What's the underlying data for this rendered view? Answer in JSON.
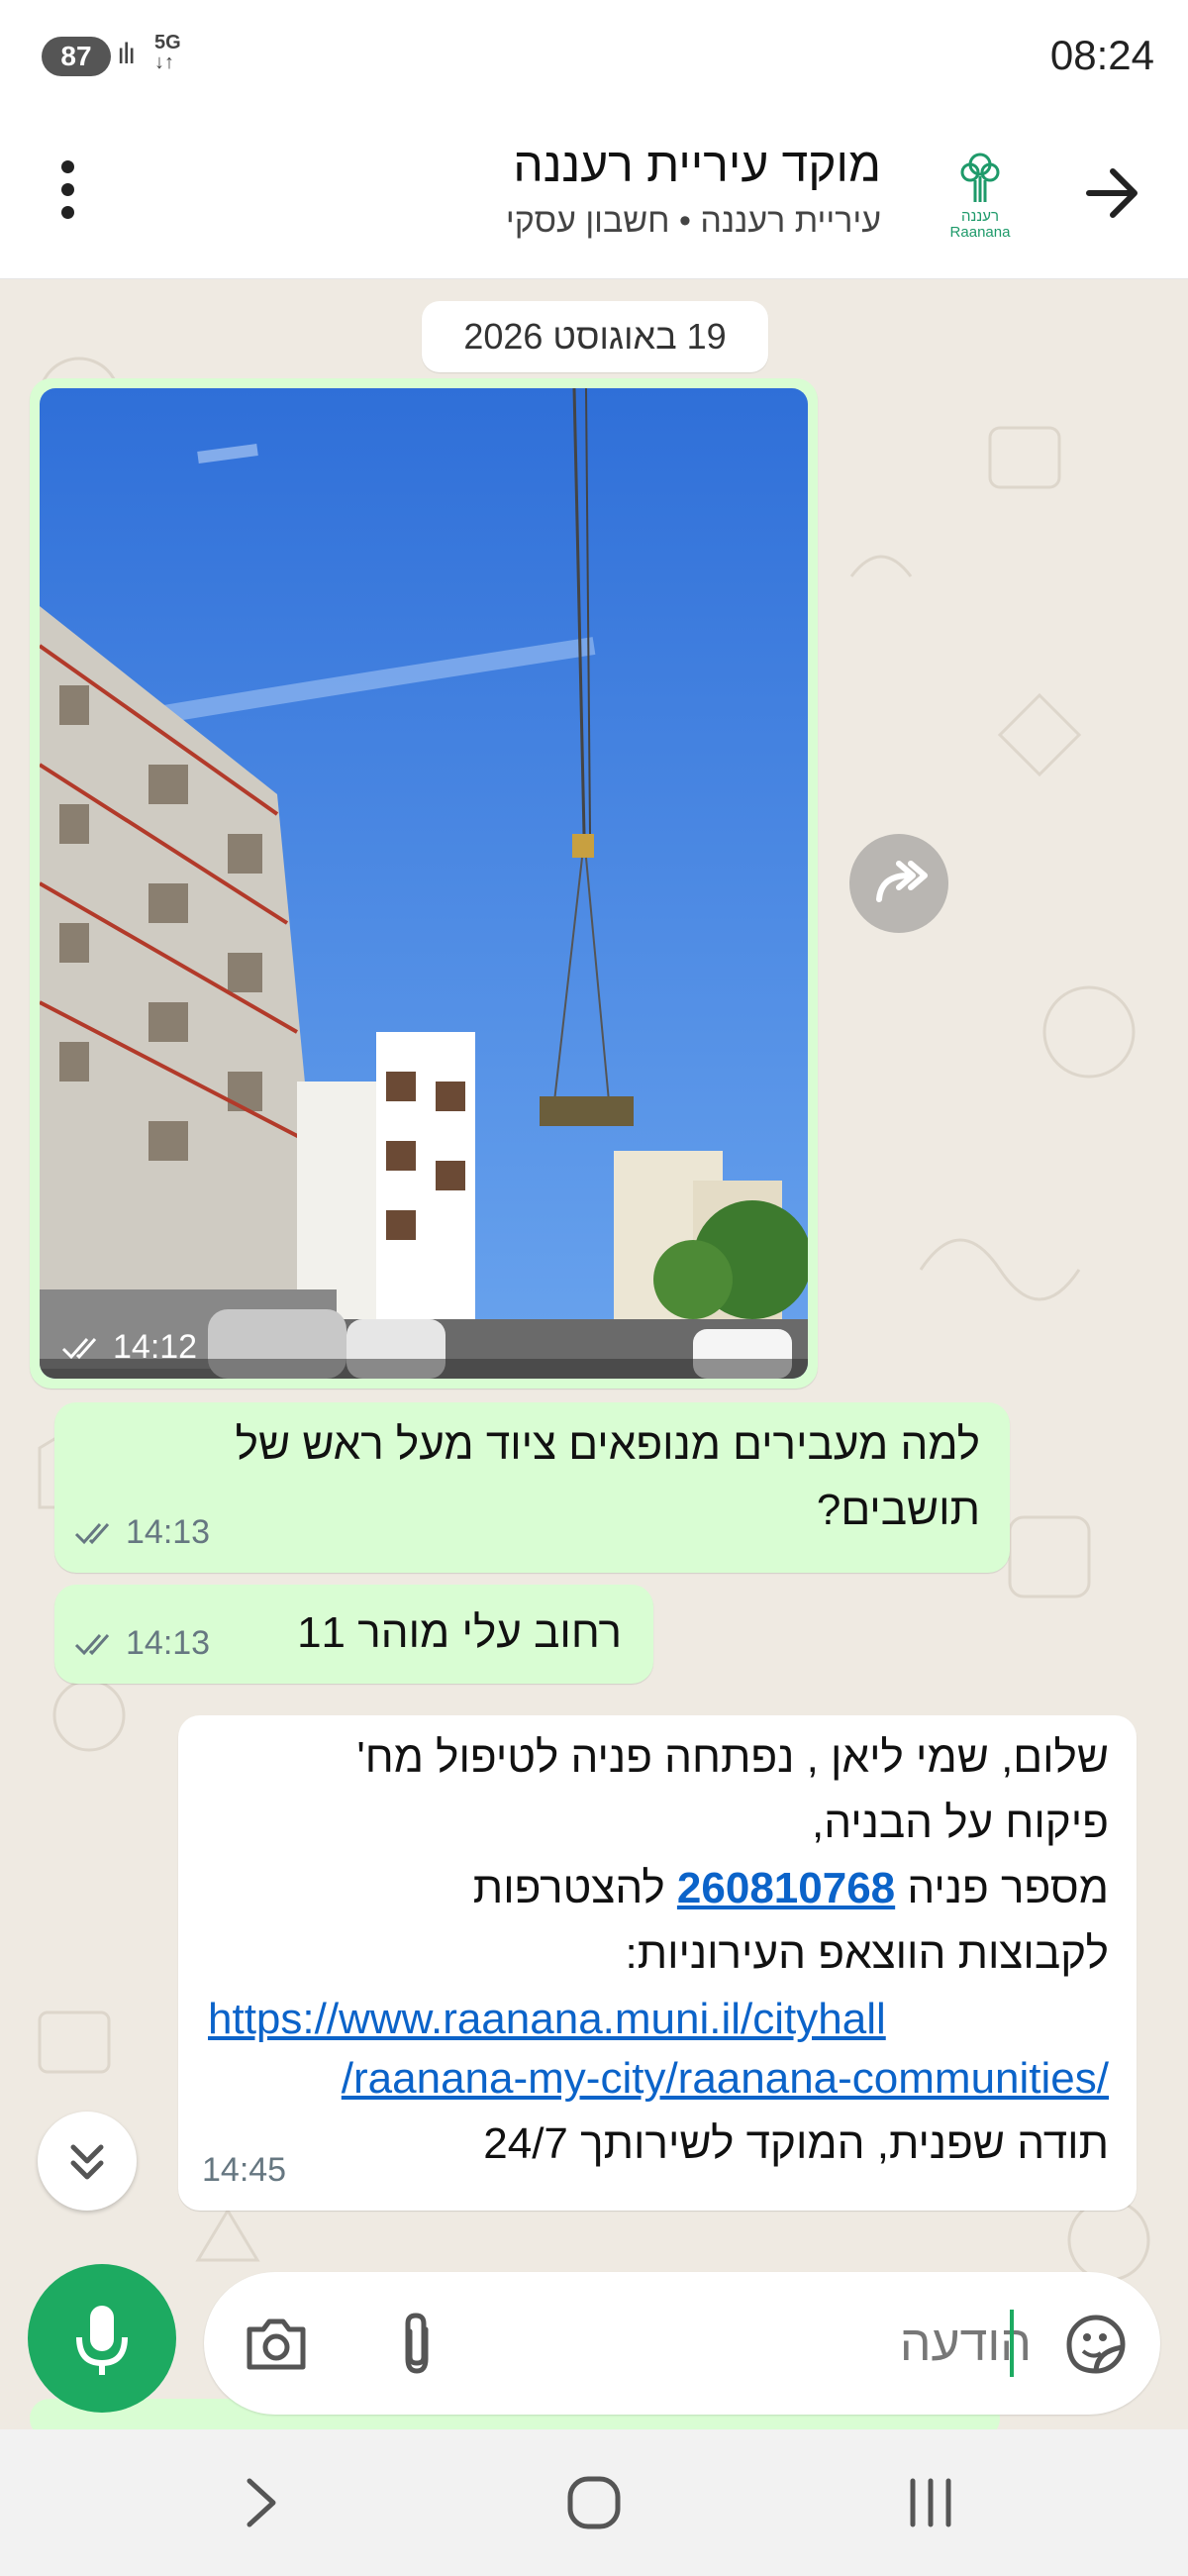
{
  "status_bar": {
    "battery": "87",
    "network": "5G",
    "time": "08:24"
  },
  "header": {
    "title": "מוקד עיריית רעננה",
    "subtitle": "עיריית רעננה • חשבון עסקי",
    "logo_text_he": "רעננה",
    "logo_text_en": "Raanana"
  },
  "chat": {
    "date_label": "19 באוגוסט 2026",
    "messages": [
      {
        "type": "image",
        "direction": "outgoing",
        "time": "14:12",
        "status": "read"
      },
      {
        "type": "text",
        "direction": "outgoing",
        "lines": [
          "למה מעבירים מנופאים ציוד  מעל ראש של",
          "תושבים?"
        ],
        "time": "14:13",
        "status": "read"
      },
      {
        "type": "text",
        "direction": "outgoing",
        "lines": [
          "רחוב עלי מוהר 11"
        ],
        "time": "14:13",
        "status": "read"
      },
      {
        "type": "text",
        "direction": "incoming",
        "line1": "שלום, שמי ליאן , נפתחה פניה לטיפול מח'",
        "line2": "פיקוח על הבניה,",
        "line3_prefix": "מספר פניה",
        "ticket_number": "260810768",
        "line3_suffix": "להצטרפות",
        "line4": "לקבוצות הווצאפ העירוניות:",
        "link_line1": "https://www.raanana.muni.il/cityhall",
        "link_line2": "/raanana-my-city/raanana-communities/",
        "line_last": "תודה שפנית, המוקד לשירותך 24/7",
        "time": "14:45"
      }
    ]
  },
  "input_bar": {
    "placeholder": "הודעה"
  },
  "colors": {
    "outgoing_bubble": "#d9fdd3",
    "incoming_bubble": "#ffffff",
    "chat_background": "#efeae2",
    "accent_green": "#1daa61",
    "link_blue": "#0b63c9",
    "read_ticks": "#667781"
  },
  "icons": {
    "back": "arrow-right-icon",
    "menu": "more-vertical-icon",
    "forward": "forward-icon",
    "scroll_down": "double-chevron-down-icon",
    "mic": "microphone-icon",
    "camera": "camera-icon",
    "attach": "paperclip-icon",
    "sticker": "sticker-icon"
  }
}
